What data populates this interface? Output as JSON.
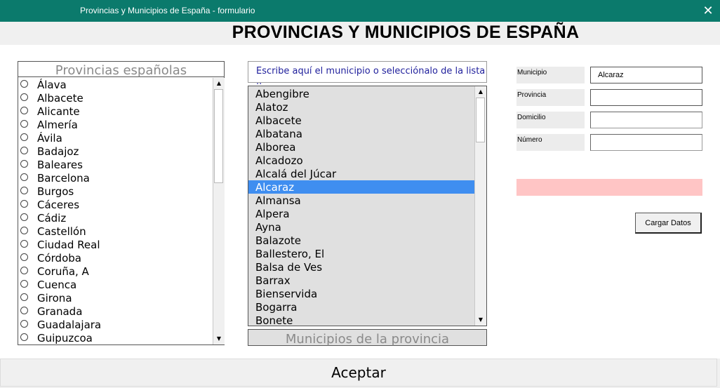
{
  "window": {
    "title": "Provincias y Municipios de España - formulario",
    "close_glyph": "✕",
    "titlebar_color": "#0b7a6c"
  },
  "header": {
    "title": "PROVINCIAS Y MUNICIPIOS DE ESPAÑA"
  },
  "provinces": {
    "caption": "Provincias españolas",
    "items": [
      "Álava",
      "Albacete",
      "Alicante",
      "Almería",
      "Ávila",
      "Badajoz",
      "Baleares",
      "Barcelona",
      "Burgos",
      "Cáceres",
      "Cádiz",
      "Castellón",
      "Ciudad Real",
      "Córdoba",
      "Coruña, A",
      "Cuenca",
      "Girona",
      "Granada",
      "Guadalajara",
      "Guipuzcoa"
    ]
  },
  "municipio_search": {
    "placeholder": "Escribe aquí el municipio o selecciónalo de la lista .."
  },
  "municipios": {
    "caption": "Municipios de la provincia",
    "items": [
      "Abengibre",
      "Alatoz",
      "Albacete",
      "Albatana",
      "Alborea",
      "Alcadozo",
      "Alcalá del Júcar",
      "Alcaraz",
      "Almansa",
      "Alpera",
      "Ayna",
      "Balazote",
      "Ballestero, El",
      "Balsa de Ves",
      "Barrax",
      "Bienservida",
      "Bogarra",
      "Bonete"
    ],
    "selected": "Alcaraz",
    "selection_color": "#3f8ef0"
  },
  "form": {
    "municipio_label": "Municipio",
    "municipio_value": "Alcaraz",
    "provincia_label": "Provincia",
    "provincia_value": "",
    "domicilio_label": "Domicilio",
    "domicilio_value": "",
    "numero_label": "Número",
    "numero_value": "",
    "message_color": "#ffc5c5",
    "cargar_label": "Cargar Datos"
  },
  "footer": {
    "aceptar_label": "Aceptar"
  },
  "icons": {
    "scroll_up": "▲",
    "scroll_down": "▼",
    "radio": "radio-unchecked-icon"
  }
}
